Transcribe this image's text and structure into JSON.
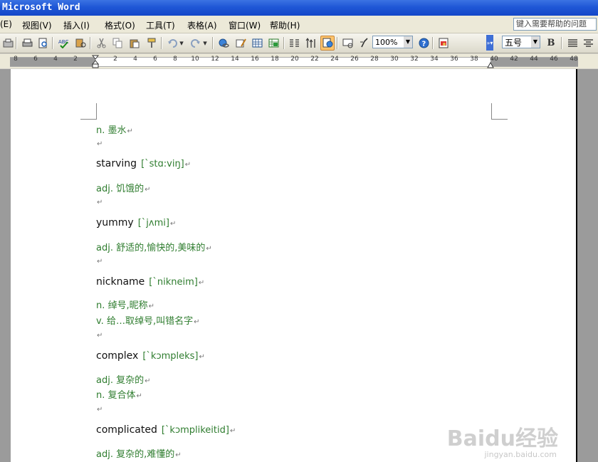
{
  "window": {
    "title": "Microsoft Word"
  },
  "menu": {
    "items": [
      "(E)",
      "视图(V)",
      "插入(I)",
      "格式(O)",
      "工具(T)",
      "表格(A)",
      "窗口(W)",
      "帮助(H)"
    ],
    "help_placeholder": "键入需要帮助的问题"
  },
  "toolbar": {
    "zoom": "100%",
    "font_size": "五号",
    "bold_label": "B"
  },
  "ruler": {
    "labels": [
      "8",
      "6",
      "4",
      "2",
      "2",
      "4",
      "6",
      "8",
      "10",
      "12",
      "14",
      "16",
      "18",
      "20",
      "22",
      "24",
      "26",
      "28",
      "30",
      "32",
      "34",
      "36",
      "38",
      "40",
      "42",
      "44",
      "46",
      "48"
    ]
  },
  "document": {
    "lines": [
      {
        "text": "n. 墨水"
      },
      {
        "text": ""
      },
      {
        "word": "starving",
        "phonetic": "[`stɑ:viŋ]"
      },
      {
        "text": "adj. 饥饿的"
      },
      {
        "text": ""
      },
      {
        "word": "yummy",
        "phonetic": "[`jʌmi]"
      },
      {
        "text": "adj. 舒适的,愉快的,美味的"
      },
      {
        "text": ""
      },
      {
        "word": "nickname",
        "phonetic": "[`nikneim]"
      },
      {
        "text": "n. 绰号,昵称"
      },
      {
        "text": "v. 给…取绰号,叫错名字"
      },
      {
        "text": ""
      },
      {
        "word": "complex",
        "phonetic": "[`kɔmpleks]"
      },
      {
        "text": "adj. 复杂的"
      },
      {
        "text": "n. 复合体"
      },
      {
        "text": ""
      },
      {
        "word": "complicated",
        "phonetic": "[`kɔmplikeitid]"
      },
      {
        "text": "adj. 复杂的,难懂的"
      }
    ],
    "para_mark": "↵"
  },
  "watermark": {
    "brand": "Baidu经验",
    "url": "jingyan.baidu.com"
  },
  "colors": {
    "definition": "#2f7d2f",
    "titlebar": "#1f57d6"
  }
}
